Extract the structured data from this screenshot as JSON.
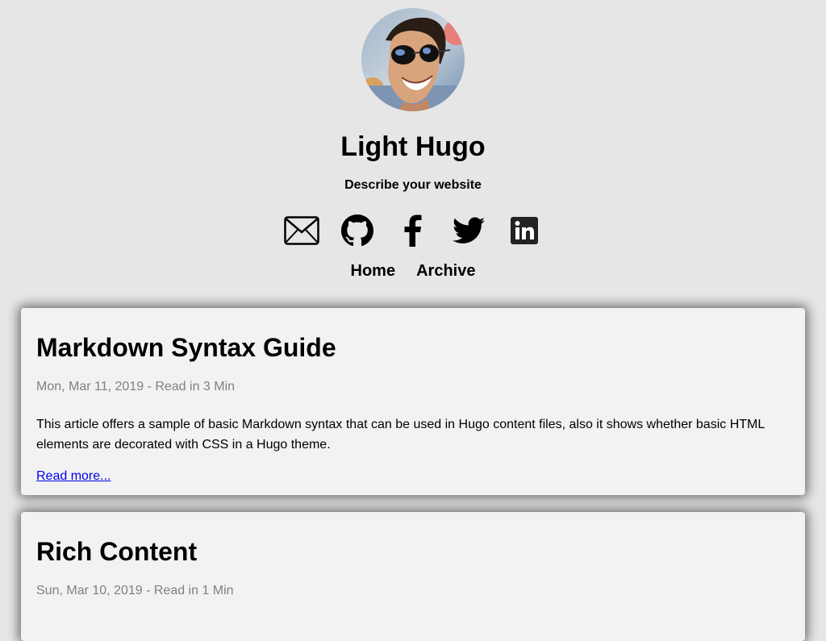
{
  "site": {
    "title": "Light Hugo",
    "description": "Describe your website"
  },
  "social": [
    {
      "icon": "email-icon"
    },
    {
      "icon": "github-icon"
    },
    {
      "icon": "facebook-icon"
    },
    {
      "icon": "twitter-icon"
    },
    {
      "icon": "linkedin-icon"
    }
  ],
  "nav": {
    "home": "Home",
    "archive": "Archive"
  },
  "posts": [
    {
      "title": "Markdown Syntax Guide",
      "meta": "Mon, Mar 11, 2019 - Read in 3 Min",
      "summary": "This article offers a sample of basic Markdown syntax that can be used in Hugo content files, also it shows whether basic HTML elements are decorated with CSS in a Hugo theme.",
      "read_more": "Read more..."
    },
    {
      "title": "Rich Content",
      "meta": "Sun, Mar 10, 2019 - Read in 1 Min"
    }
  ],
  "colors": {
    "background": "#e6e6e6",
    "card": "#f2f2f2",
    "meta_text": "#808080",
    "link": "#0000ee"
  }
}
